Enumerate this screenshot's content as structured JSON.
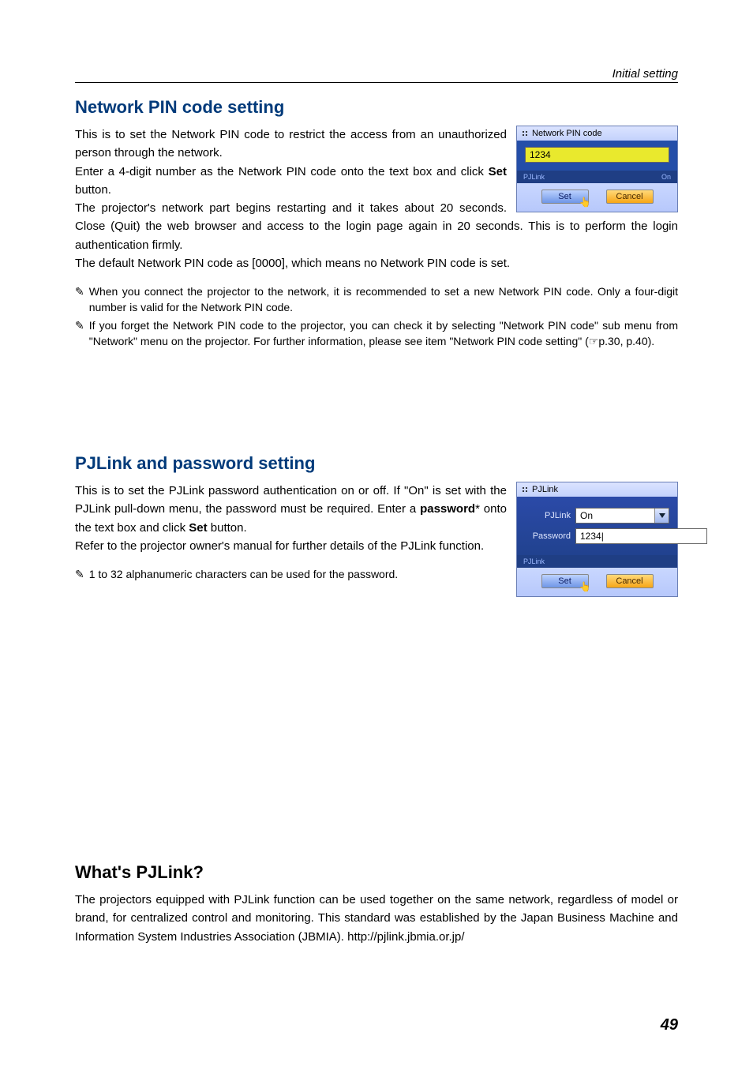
{
  "breadcrumb": "Initial setting",
  "page_number": "49",
  "pin": {
    "heading": "Network PIN code setting",
    "p1a": "This is to set the Network PIN code to restrict the access from an unauthorized person through the network.",
    "p1b_pre": "Enter a 4-digit number as the Network PIN code onto the text box and click ",
    "p1b_bold": "Set",
    "p1b_post": " button.",
    "p2": "The projector's network part begins restarting and it takes about 20 seconds. Close (Quit) the web browser and access to the login page again in 20 seconds. This is to perform the login authentication firmly.",
    "p3": "The default Network PIN code as [0000], which means no Network PIN code is set.",
    "note1": "When you connect the projector to the network, it is recommended to set a new Network PIN code. Only a four-digit number is valid for the Network PIN code.",
    "note2": "If you forget the Network PIN code to the projector, you can check it by selecting \"Network PIN code\" sub menu from \"Network\" menu on the projector. For further information, please see item \"Network PIN code setting\" (☞p.30, p.40).",
    "panel": {
      "title": "Network PIN code",
      "value": "1234",
      "row_left": "PJLink",
      "row_right": "On",
      "set": "Set",
      "cancel": "Cancel"
    }
  },
  "pjlink": {
    "heading": "PJLink and password setting",
    "p1_pre": "This is to set the PJLink password authentication on or off. If \"On\" is set with the PJLink pull-down menu, the password must be required. Enter a ",
    "p1_bold": "password",
    "p1_mid": "* onto the text box and click ",
    "p1_bold2": "Set",
    "p1_post": " button.",
    "p2": "Refer to the projector owner's manual for further details of the PJLink function.",
    "note1": "1 to 32 alphanumeric characters can be used for the password.",
    "panel": {
      "title": "PJLink",
      "label_pjlink": "PJLink",
      "value_pjlink": "On",
      "label_password": "Password",
      "value_password": "1234|",
      "side": "PJLink",
      "set": "Set",
      "cancel": "Cancel"
    }
  },
  "whats": {
    "heading": "What's PJLink?",
    "p1": "The projectors equipped with PJLink function can be used together on the same network, regardless of model or brand, for centralized control and monitoring. This standard was established by the Japan Business Machine and Information System Industries Association (JBMIA). http://pjlink.jbmia.or.jp/"
  },
  "note_marker": "✎"
}
